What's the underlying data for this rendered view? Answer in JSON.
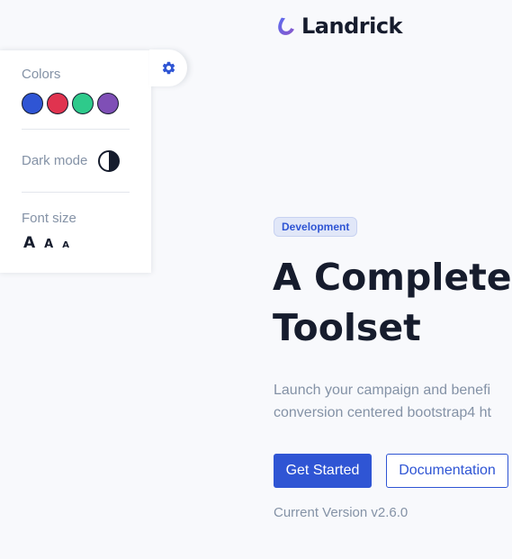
{
  "brand": {
    "name": "Landrick",
    "icon": "landrick-logo-icon",
    "accent": "#2f55d4"
  },
  "settings": {
    "toggle_icon": "gear-icon",
    "colors_label": "Colors",
    "swatches": [
      {
        "name": "blue",
        "color": "#2f55d4"
      },
      {
        "name": "red",
        "color": "#e0334f"
      },
      {
        "name": "green",
        "color": "#2eca8b"
      },
      {
        "name": "purple",
        "color": "#7f4fb6"
      }
    ],
    "dark_mode_label": "Dark mode",
    "dark_mode_icon": "contrast-icon",
    "font_size_label": "Font size",
    "font_sizes": [
      "A",
      "A",
      "A"
    ]
  },
  "hero": {
    "badge": "Development",
    "title_line1": "A Complete",
    "title_line2": "Toolset",
    "desc_line1": "Launch your campaign and benefi",
    "desc_line2": "conversion centered bootstrap4 ht",
    "primary_button": "Get Started",
    "secondary_button": "Documentation",
    "version": "Current Version v2.6.0"
  }
}
